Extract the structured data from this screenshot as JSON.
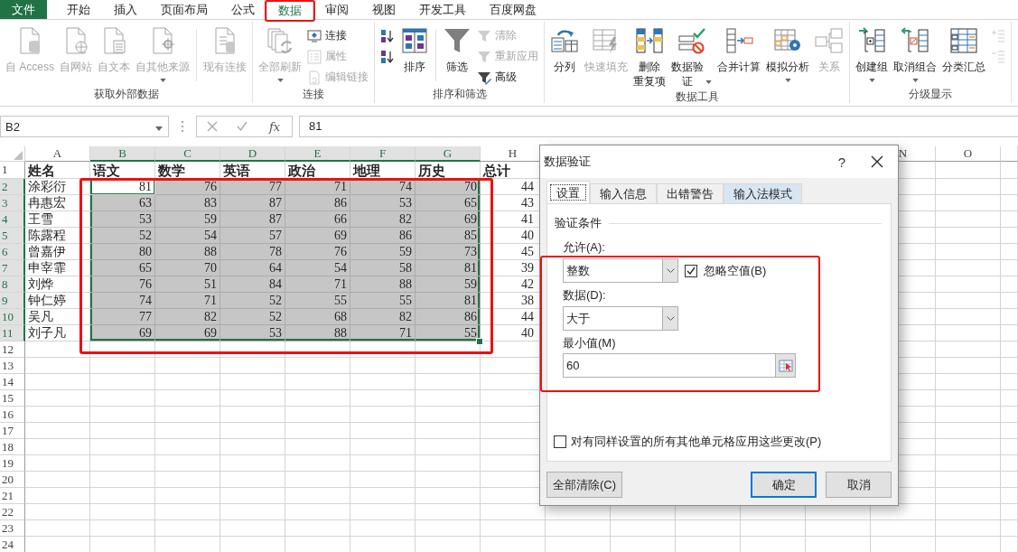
{
  "menu_tabs": [
    {
      "label": "文件",
      "kind": "file",
      "selected": false,
      "highlighted": false
    },
    {
      "label": "开始",
      "kind": "tab",
      "selected": false,
      "highlighted": false
    },
    {
      "label": "插入",
      "kind": "tab",
      "selected": false,
      "highlighted": false
    },
    {
      "label": "页面布局",
      "kind": "tab",
      "selected": false,
      "highlighted": false
    },
    {
      "label": "公式",
      "kind": "tab",
      "selected": false,
      "highlighted": false
    },
    {
      "label": "数据",
      "kind": "tab",
      "selected": true,
      "highlighted": true
    },
    {
      "label": "审阅",
      "kind": "tab",
      "selected": false,
      "highlighted": false
    },
    {
      "label": "视图",
      "kind": "tab",
      "selected": false,
      "highlighted": false
    },
    {
      "label": "开发工具",
      "kind": "tab",
      "selected": false,
      "highlighted": false
    },
    {
      "label": "百度网盘",
      "kind": "tab",
      "selected": false,
      "highlighted": false
    }
  ],
  "ribbon": {
    "groups": [
      {
        "label": "获取外部数据",
        "items": [
          {
            "kind": "large",
            "lines": [
              "自 Access"
            ],
            "disabled": true,
            "dropdown": false
          },
          {
            "kind": "large",
            "lines": [
              "自网站"
            ],
            "disabled": true,
            "dropdown": false
          },
          {
            "kind": "large",
            "lines": [
              "自文本"
            ],
            "disabled": true,
            "dropdown": false
          },
          {
            "kind": "large",
            "lines": [
              "自其他来源"
            ],
            "disabled": true,
            "dropdown": true
          },
          {
            "kind": "separator"
          },
          {
            "kind": "large",
            "lines": [
              "现有连接"
            ],
            "disabled": true,
            "dropdown": false
          }
        ]
      },
      {
        "label": "连接",
        "items": [
          {
            "kind": "large",
            "lines": [
              "全部刷新"
            ],
            "disabled": true,
            "dropdown": true
          },
          {
            "kind": "stack",
            "items": [
              {
                "label": "连接",
                "disabled": false
              },
              {
                "label": "属性",
                "disabled": true
              },
              {
                "label": "编辑链接",
                "disabled": true
              }
            ]
          }
        ]
      },
      {
        "label": "排序和筛选",
        "items": [
          {
            "kind": "stack",
            "items": [
              {
                "disabled": false
              },
              {
                "disabled": false
              }
            ]
          },
          {
            "kind": "large",
            "lines": [
              "排序"
            ],
            "disabled": false,
            "dropdown": false
          },
          {
            "kind": "separator"
          },
          {
            "kind": "large",
            "lines": [
              "筛选"
            ],
            "disabled": false,
            "dropdown": false
          },
          {
            "kind": "stack",
            "items": [
              {
                "label": "清除",
                "disabled": true
              },
              {
                "label": "重新应用",
                "disabled": true
              },
              {
                "label": "高级",
                "disabled": false
              }
            ]
          }
        ]
      },
      {
        "label": "数据工具",
        "items": [
          {
            "kind": "large",
            "lines": [
              "分列"
            ],
            "disabled": false,
            "dropdown": false
          },
          {
            "kind": "large",
            "lines": [
              "快速填充"
            ],
            "disabled": true,
            "dropdown": false
          },
          {
            "kind": "large",
            "lines": [
              "删除",
              "重复项"
            ],
            "disabled": false,
            "dropdown": false
          },
          {
            "kind": "large",
            "lines": [
              "数据验",
              "证"
            ],
            "disabled": false,
            "dropdown": true
          },
          {
            "kind": "large",
            "lines": [
              "合并计算"
            ],
            "disabled": false,
            "dropdown": false
          },
          {
            "kind": "large",
            "lines": [
              "模拟分析"
            ],
            "disabled": false,
            "dropdown": true
          },
          {
            "kind": "large",
            "lines": [
              "关系"
            ],
            "disabled": true,
            "dropdown": false
          }
        ]
      },
      {
        "label": "分级显示",
        "items": [
          {
            "kind": "large",
            "lines": [
              "创建组"
            ],
            "disabled": false,
            "dropdown": true
          },
          {
            "kind": "large",
            "lines": [
              "取消组合"
            ],
            "disabled": false,
            "dropdown": true
          },
          {
            "kind": "large",
            "lines": [
              "分类汇总"
            ],
            "disabled": false,
            "dropdown": false
          },
          {
            "kind": "stack",
            "items": [
              {
                "disabled": true
              },
              {
                "disabled": true
              }
            ]
          }
        ]
      }
    ]
  },
  "formula_bar": {
    "cell_reference": "B2",
    "function_label": "fx",
    "value": "81"
  },
  "sheet": {
    "highlighted": true,
    "columns": [
      {
        "label": "A",
        "selected": false,
        "kind": "text"
      },
      {
        "label": "B",
        "selected": true,
        "kind": "number"
      },
      {
        "label": "C",
        "selected": true,
        "kind": "number"
      },
      {
        "label": "D",
        "selected": true,
        "kind": "number"
      },
      {
        "label": "E",
        "selected": true,
        "kind": "number"
      },
      {
        "label": "F",
        "selected": true,
        "kind": "number"
      },
      {
        "label": "G",
        "selected": true,
        "kind": "number"
      },
      {
        "label": "H",
        "selected": false,
        "kind": "cut"
      }
    ],
    "far_columns": [
      {
        "label": "N",
        "selected": false
      },
      {
        "label": "O",
        "selected": false
      }
    ],
    "rows": [
      {
        "number": "1",
        "kind": "header",
        "selected": false,
        "active": false,
        "cells": [
          "姓名",
          "语文",
          "数学",
          "英语",
          "政治",
          "地理",
          "历史",
          "总计"
        ]
      },
      {
        "number": "2",
        "kind": "data",
        "selected": true,
        "active": true,
        "cells": [
          "涂彩衍",
          "81",
          "76",
          "77",
          "71",
          "74",
          "70",
          "44"
        ]
      },
      {
        "number": "3",
        "kind": "data",
        "selected": true,
        "active": false,
        "cells": [
          "冉惠宏",
          "63",
          "83",
          "87",
          "86",
          "53",
          "65",
          "43"
        ]
      },
      {
        "number": "4",
        "kind": "data",
        "selected": true,
        "active": false,
        "cells": [
          "王雪",
          "53",
          "59",
          "87",
          "66",
          "82",
          "69",
          "41"
        ]
      },
      {
        "number": "5",
        "kind": "data",
        "selected": true,
        "active": false,
        "cells": [
          "陈露程",
          "52",
          "54",
          "57",
          "69",
          "86",
          "85",
          "40"
        ]
      },
      {
        "number": "6",
        "kind": "data",
        "selected": true,
        "active": false,
        "cells": [
          "曾嘉伊",
          "80",
          "88",
          "78",
          "76",
          "59",
          "73",
          "45"
        ]
      },
      {
        "number": "7",
        "kind": "data",
        "selected": true,
        "active": false,
        "cells": [
          "申宰霏",
          "65",
          "70",
          "64",
          "54",
          "58",
          "81",
          "39"
        ]
      },
      {
        "number": "8",
        "kind": "data",
        "selected": true,
        "active": false,
        "cells": [
          "刘烨",
          "76",
          "51",
          "84",
          "71",
          "88",
          "59",
          "42"
        ]
      },
      {
        "number": "9",
        "kind": "data",
        "selected": true,
        "active": false,
        "cells": [
          "钟仁婷",
          "74",
          "71",
          "52",
          "55",
          "55",
          "81",
          "38"
        ]
      },
      {
        "number": "10",
        "kind": "data",
        "selected": true,
        "active": false,
        "cells": [
          "吴凡",
          "77",
          "82",
          "52",
          "68",
          "82",
          "86",
          "44"
        ]
      },
      {
        "number": "11",
        "kind": "data",
        "selected": true,
        "active": false,
        "cells": [
          "刘子凡",
          "69",
          "69",
          "53",
          "88",
          "71",
          "55",
          "40"
        ]
      },
      {
        "number": "12",
        "kind": "data",
        "selected": false,
        "active": false
      },
      {
        "number": "13",
        "kind": "data",
        "selected": false,
        "active": false
      },
      {
        "number": "14",
        "kind": "data",
        "selected": false,
        "active": false
      },
      {
        "number": "15",
        "kind": "data",
        "selected": false,
        "active": false
      },
      {
        "number": "16",
        "kind": "data",
        "selected": false,
        "active": false
      },
      {
        "number": "17",
        "kind": "data",
        "selected": false,
        "active": false
      },
      {
        "number": "18",
        "kind": "data",
        "selected": false,
        "active": false
      },
      {
        "number": "19",
        "kind": "data",
        "selected": false,
        "active": false
      },
      {
        "number": "20",
        "kind": "data",
        "selected": false,
        "active": false
      },
      {
        "number": "21",
        "kind": "data",
        "selected": false,
        "active": false
      },
      {
        "number": "22",
        "kind": "data",
        "selected": false,
        "active": false
      },
      {
        "number": "23",
        "kind": "data",
        "selected": false,
        "active": false
      },
      {
        "number": "24",
        "kind": "data",
        "selected": false,
        "active": false
      }
    ]
  },
  "dialog": {
    "title": "数据验证",
    "help": "?",
    "tabs": [
      {
        "label": "设置",
        "selected": true,
        "hovered": false
      },
      {
        "label": "输入信息",
        "selected": false,
        "hovered": false
      },
      {
        "label": "出错警告",
        "selected": false,
        "hovered": false
      },
      {
        "label": "输入法模式",
        "selected": false,
        "hovered": true
      }
    ],
    "section": "验证条件",
    "highlighted": true,
    "allow": {
      "label": "允许(A):",
      "value": "整数"
    },
    "ignore_blank": {
      "label": "忽略空值(B)",
      "checked": true
    },
    "data": {
      "label": "数据(D):",
      "value": "大于"
    },
    "minimum": {
      "label": "最小值(M)",
      "value": "60"
    },
    "apply_all": {
      "label": "对有同样设置的所有其他单元格应用这些更改(P)",
      "checked": false
    },
    "buttons": [
      {
        "label": "全部清除(C)",
        "default": false
      },
      {
        "label": "确定",
        "default": true
      },
      {
        "label": "取消",
        "default": false
      }
    ]
  }
}
